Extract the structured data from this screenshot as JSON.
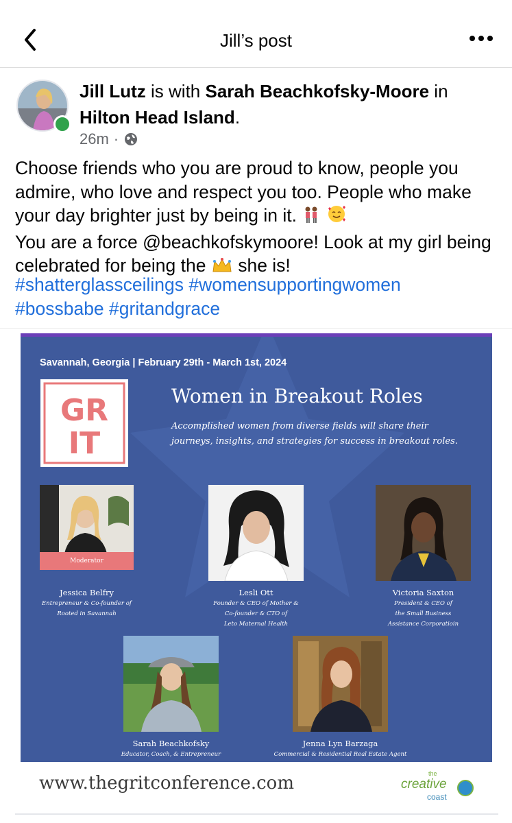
{
  "header": {
    "title": "Jill’s post",
    "back_icon": "chevron-left-icon",
    "more_icon": "ellipsis-icon"
  },
  "post": {
    "author": "Jill Lutz",
    "is_with": "is with",
    "tagged_person": "Sarah Beachkofsky-Moore",
    "in": "in",
    "location": "Hilton Head Island",
    "period": ".",
    "time": "26m",
    "separator": "·",
    "privacy_icon": "globe-icon",
    "text_line1": "Choose friends who you are proud to know, people you admire, who love and respect you too. People who make your day brighter just by being in it.",
    "text_line2a": "You are a force @beachkofskymoore! Look at my girl being celebrated for being the",
    "text_line2b": "she is!",
    "hashtags": [
      "#shatterglassceilings",
      "#womensupportingwomen",
      "#bossbabe",
      "#gritandgrace"
    ]
  },
  "poster": {
    "date_line": "Savannah, Georgia | February 29th - March 1st, 2024",
    "logo_text": [
      "GR",
      "IT"
    ],
    "title": "Women in Breakout Roles",
    "subtitle": "Accomplished women from diverse fields will share their journeys, insights, and strategies for success in breakout roles.",
    "moderator_label": "Moderator",
    "speakers": [
      {
        "name": "Jessica Belfry",
        "role_line1": "Entrepreneur & Co-founder of",
        "role_line2": "Rooted in Savannah",
        "role_line3": ""
      },
      {
        "name": "Lesli Ott",
        "role_line1": "Founder & CEO of Mother &",
        "role_line2": "Co-founder & CTO of",
        "role_line3": "Leto Maternal Health"
      },
      {
        "name": "Victoria Saxton",
        "role_line1": "President & CEO of",
        "role_line2": "the Small Business",
        "role_line3": "Assistance Corporatioin"
      },
      {
        "name": "Sarah Beachkofsky",
        "role_line1": "Educator, Coach, & Entrepreneur",
        "role_line2": "",
        "role_line3": ""
      },
      {
        "name": "Jenna Lyn Barzaga",
        "role_line1": "Commercial & Residential Real Estate Agent",
        "role_line2": "",
        "role_line3": ""
      }
    ],
    "url": "www.thegritconference.com",
    "brand": {
      "the": "the",
      "creative": "creative",
      "coast": "coast"
    }
  },
  "colors": {
    "link_blue": "#216fdb",
    "poster_blue": "#3f5a9c",
    "grit_pink": "#e8787a",
    "online_green": "#31a24c"
  }
}
